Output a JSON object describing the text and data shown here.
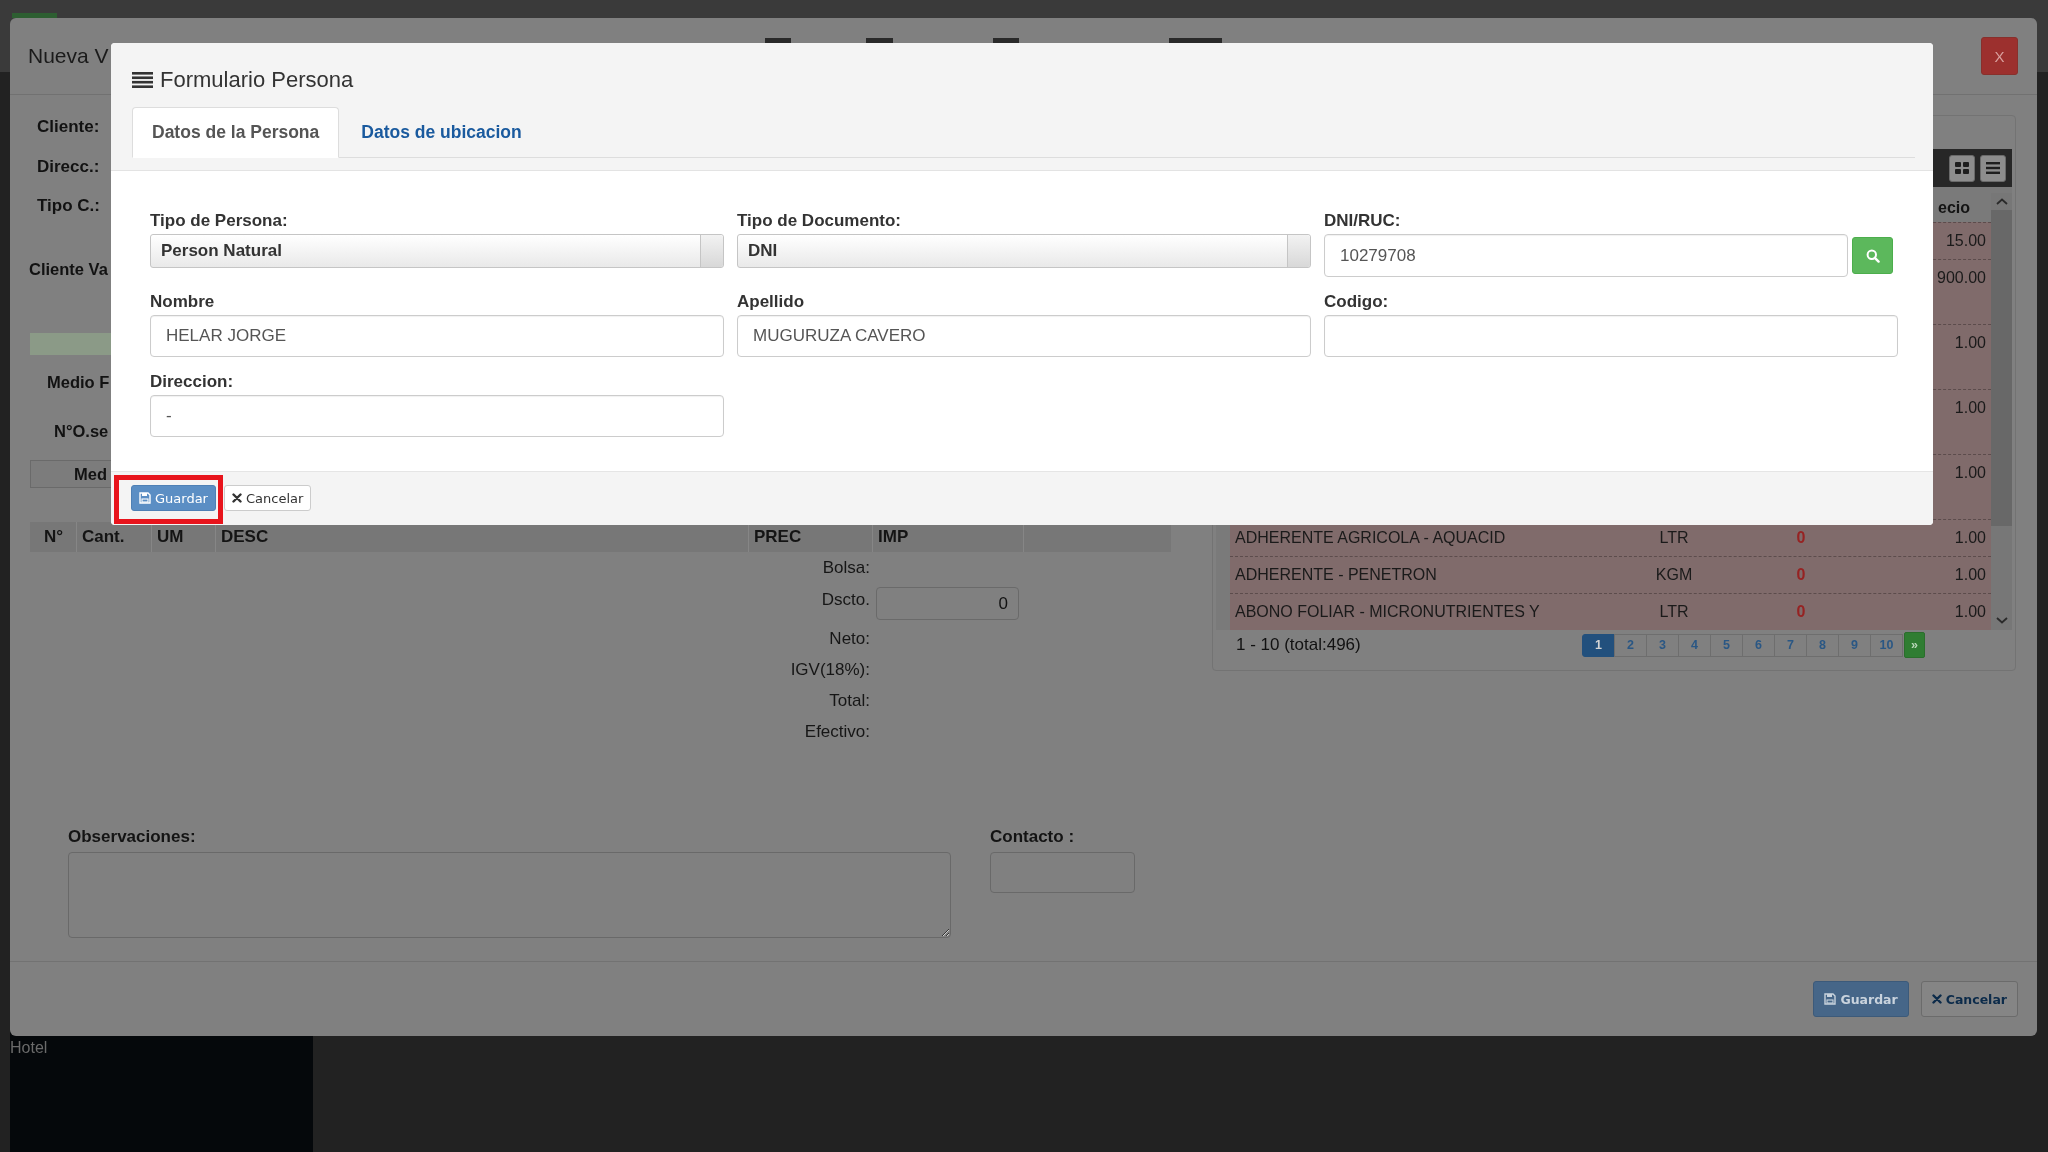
{
  "sidebar": {
    "items": [
      "Hotel"
    ]
  },
  "sale_dialog": {
    "title": "Nueva V",
    "close_label": "X",
    "customer_fields": [
      "Cliente:",
      "Direcc.:",
      "Tipo C.:"
    ],
    "client_label": "Cliente Va",
    "payment_label": "Medio F",
    "order_label": "N°O.se",
    "section_box": "Med",
    "items_table": {
      "columns": [
        "N°",
        "Cant.",
        "UM",
        "DESC",
        "PREC",
        "IMP"
      ]
    },
    "totals": [
      {
        "label": "Bolsa:",
        "kind": "text"
      },
      {
        "label": "Dscto.",
        "kind": "input",
        "value": "0"
      },
      {
        "label": "Neto:",
        "kind": "text"
      },
      {
        "label": "IGV(18%):",
        "kind": "text"
      },
      {
        "label": "Total:",
        "kind": "text"
      },
      {
        "label": "Efectivo:",
        "kind": "text"
      }
    ],
    "notes": {
      "label": "Observaciones:"
    },
    "contact": {
      "label": "Contacto :"
    },
    "buttons": [
      {
        "label": "Guardar",
        "kind": "primary"
      },
      {
        "label": "Cancelar",
        "kind": "cancel"
      }
    ],
    "products": {
      "price_header": "ecio",
      "rows": [
        {
          "price": "15.00",
          "two_line": false
        },
        {
          "price": "900.00",
          "two_line": true
        },
        {
          "price": "1.00",
          "two_line": true
        },
        {
          "price": "1.00",
          "two_line": true
        },
        {
          "price": "1.00",
          "two_line": true
        },
        {
          "description": "ADHERENTE AGRICOLA - AQUACID",
          "unit": "LTR",
          "stock": "0",
          "price": "1.00",
          "two_line": false
        },
        {
          "description": "ADHERENTE - PENETRON",
          "unit": "KGM",
          "stock": "0",
          "price": "1.00",
          "two_line": false
        },
        {
          "description": "ABONO FOLIAR - MICRONUTRIENTES Y",
          "unit": "LTR",
          "stock": "0",
          "price": "1.00",
          "two_line": false
        }
      ],
      "range": "1 - 10 (total:496)",
      "pages": [
        {
          "label": "1",
          "selected": true
        },
        {
          "label": "2",
          "selected": false
        },
        {
          "label": "3",
          "selected": false
        },
        {
          "label": "4",
          "selected": false
        },
        {
          "label": "5",
          "selected": false
        },
        {
          "label": "6",
          "selected": false
        },
        {
          "label": "7",
          "selected": false
        },
        {
          "label": "8",
          "selected": false
        },
        {
          "label": "9",
          "selected": false
        },
        {
          "label": "10",
          "selected": false
        }
      ],
      "next_label": "»"
    }
  },
  "person_dialog": {
    "title": "Formulario Persona",
    "tabs": [
      {
        "label": "Datos de la Persona",
        "selected": true
      },
      {
        "label": "Datos de ubicacion",
        "selected": false
      }
    ],
    "fields": [
      {
        "label": "Tipo de Persona:",
        "kind": "select",
        "value": "Person Natural"
      },
      {
        "label": "Tipo de Documento:",
        "kind": "select",
        "value": "DNI"
      },
      {
        "label": "DNI/RUC:",
        "kind": "search",
        "value": "10279708"
      },
      {
        "label": "Nombre",
        "kind": "text",
        "value": "HELAR JORGE"
      },
      {
        "label": "Apellido",
        "kind": "text",
        "value": "MUGURUZA CAVERO"
      },
      {
        "label": "Codigo:",
        "kind": "text"
      },
      {
        "label": "Direccion:",
        "kind": "text",
        "value": "-"
      }
    ],
    "buttons": [
      {
        "label": "Guardar",
        "kind": "primary",
        "highlighted": true
      },
      {
        "label": "Cancelar",
        "kind": "cancel"
      }
    ]
  }
}
